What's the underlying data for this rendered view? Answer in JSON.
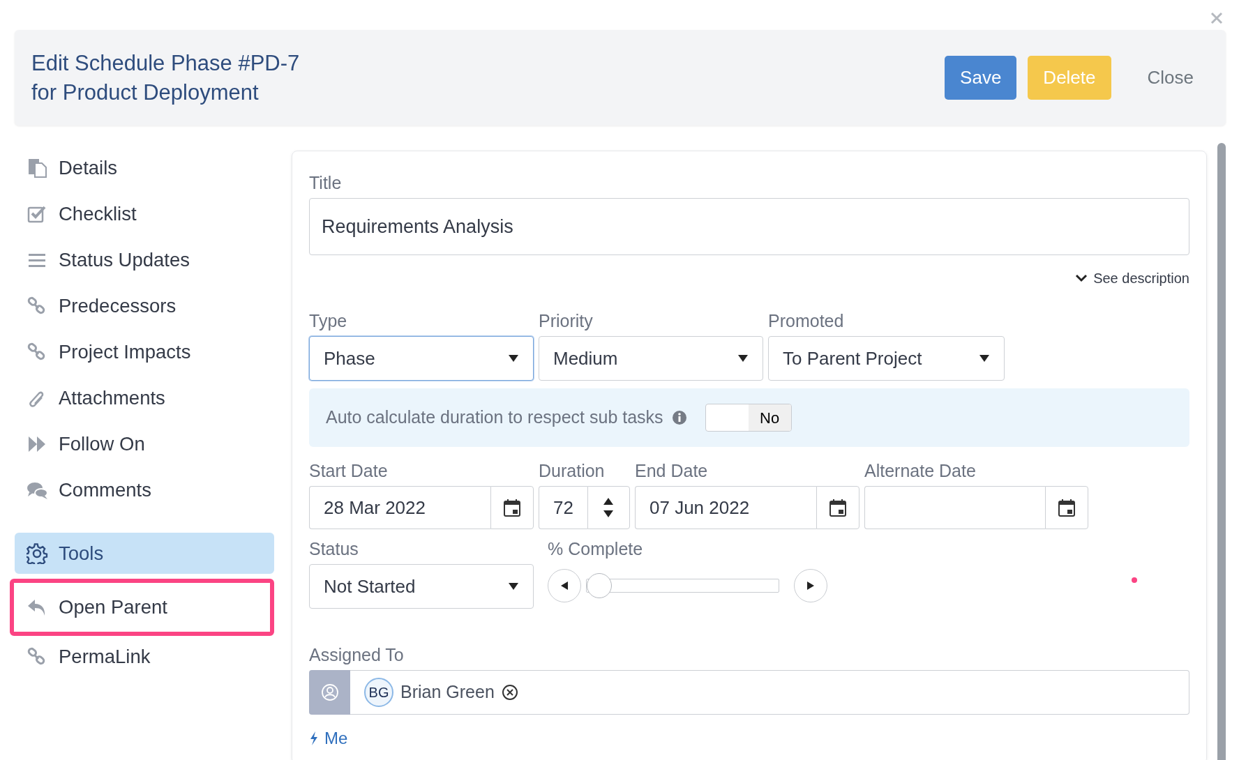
{
  "header": {
    "title_lines": [
      "Edit Schedule Phase #PD-7",
      "for Product Deployment"
    ],
    "buttons": [
      {
        "label": "Save",
        "kind": "primary"
      },
      {
        "label": "Delete",
        "kind": "warning"
      },
      {
        "label": "Close",
        "kind": "link"
      }
    ]
  },
  "sidebar": {
    "items": [
      {
        "label": "Details",
        "selected": false,
        "highlighted": false
      },
      {
        "label": "Checklist",
        "selected": false,
        "highlighted": false
      },
      {
        "label": "Status Updates",
        "selected": false,
        "highlighted": false
      },
      {
        "label": "Predecessors",
        "selected": false,
        "highlighted": false
      },
      {
        "label": "Project Impacts",
        "selected": false,
        "highlighted": false
      },
      {
        "label": "Attachments",
        "selected": false,
        "highlighted": false
      },
      {
        "label": "Follow On",
        "selected": false,
        "highlighted": false
      },
      {
        "label": "Comments",
        "selected": false,
        "highlighted": false
      },
      {
        "label": "Tools",
        "selected": true,
        "highlighted": false
      },
      {
        "label": "Open Parent",
        "selected": false,
        "highlighted": true
      },
      {
        "label": "PermaLink",
        "selected": false,
        "highlighted": false
      }
    ]
  },
  "form": {
    "title": {
      "label": "Title",
      "value": "Requirements Analysis"
    },
    "see_description": "See description",
    "selects": [
      {
        "label": "Type",
        "value": "Phase",
        "focused": true
      },
      {
        "label": "Priority",
        "value": "Medium",
        "focused": false
      },
      {
        "label": "Promoted",
        "value": "To Parent Project",
        "focused": false
      }
    ],
    "auto_calculate": {
      "text": "Auto calculate duration to respect sub tasks",
      "toggle": {
        "label": "No",
        "on": false
      }
    },
    "dates": [
      {
        "label": "Start Date",
        "value": "28 Mar 2022",
        "kind": "date"
      },
      {
        "label": "Duration",
        "value": "72",
        "kind": "number"
      },
      {
        "label": "End Date",
        "value": "07 Jun 2022",
        "kind": "date"
      },
      {
        "label": "Alternate Date",
        "kind": "date"
      }
    ],
    "status": {
      "label": "Status",
      "value": "Not Started"
    },
    "percent_complete": {
      "label": "% Complete",
      "level": 0
    },
    "assigned_to": {
      "label": "Assigned To",
      "people": [
        {
          "initials": "BG",
          "name": "Brian Green"
        }
      ]
    },
    "me_link": "Me"
  }
}
